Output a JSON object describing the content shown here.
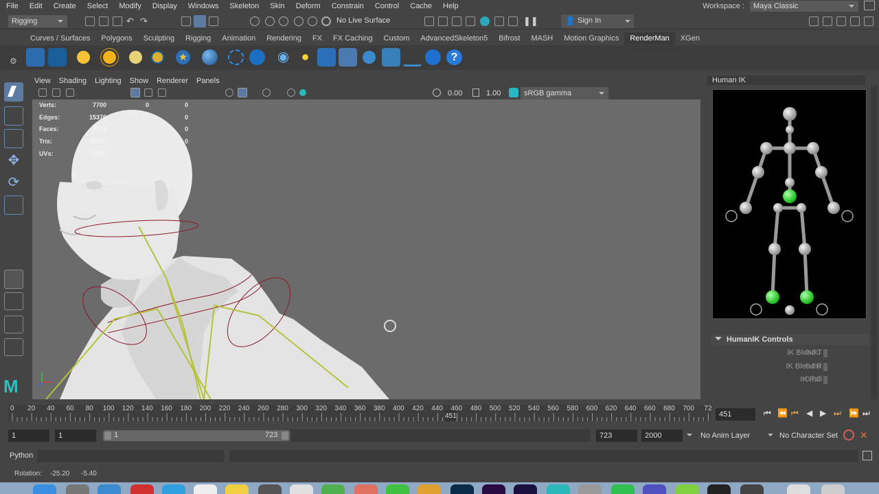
{
  "menubar": {
    "items": [
      "File",
      "Edit",
      "Create",
      "Select",
      "Modify",
      "Display",
      "Windows",
      "Skeleton",
      "Skin",
      "Deform",
      "Constrain",
      "Control",
      "Cache",
      "Help"
    ],
    "workspace_label": "Workspace :",
    "workspace_value": "Maya Classic"
  },
  "statusline": {
    "menuset": "Rigging",
    "live_surface": "No Live Surface",
    "sign_in": "Sign In"
  },
  "shelf_tabs": {
    "items": [
      "Curves / Surfaces",
      "Polygons",
      "Sculpting",
      "Rigging",
      "Animation",
      "Rendering",
      "FX",
      "FX Caching",
      "Custom",
      "AdvancedSkeleton5",
      "Bifrost",
      "MASH",
      "Motion Graphics",
      "RenderMan",
      "XGen"
    ],
    "active": "RenderMan"
  },
  "panel": {
    "menu": [
      "View",
      "Shading",
      "Lighting",
      "Show",
      "Renderer",
      "Panels"
    ],
    "exposure": "0.00",
    "gamma": "1.00",
    "colorspace": "sRGB gamma"
  },
  "hud": {
    "labels": [
      "Verts:",
      "Edges:",
      "Faces:",
      "Tris:",
      "UVs:"
    ],
    "col1": [
      "7700",
      "15376",
      "7678",
      "15322",
      "7597"
    ],
    "col2": [
      "0",
      "0",
      "0",
      "0",
      "0"
    ],
    "col3": [
      "0",
      "0",
      "0",
      "0",
      "0"
    ]
  },
  "humanik": {
    "title": "Human IK",
    "controls_header": "HumanIK Controls",
    "rows": [
      {
        "label": "IK Blend T",
        "value": "0.00"
      },
      {
        "label": "IK Blend R",
        "value": "0.00"
      },
      {
        "label": "IK Pull",
        "value": "0.00"
      }
    ]
  },
  "timeline": {
    "ticks": [
      "0",
      "20",
      "40",
      "60",
      "80",
      "100",
      "120",
      "140",
      "160",
      "180",
      "200",
      "220",
      "240",
      "260",
      "280",
      "300",
      "320",
      "340",
      "360",
      "380",
      "400",
      "420",
      "440",
      "460",
      "480",
      "500",
      "520",
      "540",
      "560",
      "580",
      "600",
      "620",
      "640",
      "660",
      "680",
      "700",
      "72"
    ],
    "current_frame": "451",
    "current_frame_field": "451"
  },
  "range": {
    "start": "1",
    "playback_start": "1",
    "slider_start": "1",
    "slider_end": "723",
    "playback_end": "723",
    "end": "2000",
    "anim_layer": "No Anim Layer",
    "character_set": "No Character Set"
  },
  "cmdline": {
    "language": "Python"
  },
  "helpline": {
    "label": "Rotation:",
    "x": "-25.20",
    "y": "-5.40"
  },
  "colors": {
    "bg": "#444444",
    "viewport": "#6b6b6b",
    "joint": "#c8c8c8",
    "active_joint": "#22dd22",
    "skeleton": "#b5c23a",
    "curves": "#8b1a2a"
  }
}
